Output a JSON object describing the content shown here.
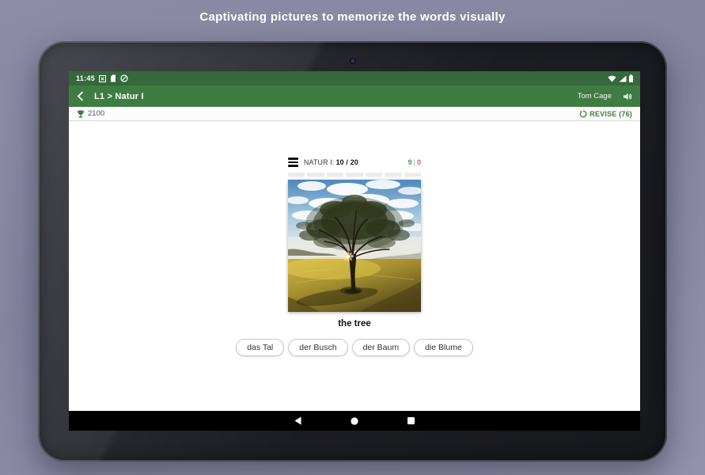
{
  "caption": "Captivating pictures to memorize the words visually",
  "colors": {
    "background_purple": "#8b8aa4",
    "status_bar_green": "#35683a",
    "app_bar_green": "#3f7c42",
    "revise_green": "#3f7c42",
    "correct_green": "#43a047",
    "wrong_red": "#e05a52"
  },
  "tablet": {
    "status_bar": {
      "time": "11:45"
    },
    "app_bar": {
      "breadcrumb": "L1 > Natur I",
      "user": "Tom Cage"
    },
    "points_bar": {
      "points": "2100",
      "revise_label": "REVISE (76)"
    },
    "quiz": {
      "lesson": "NATUR I:",
      "progress": "10 / 20",
      "score_correct": "9",
      "score_divider": "|",
      "score_wrong": "0",
      "progress_segments": 7,
      "word": "the tree",
      "answers": [
        "das Tal",
        "der Busch",
        "der Baum",
        "die Blume"
      ]
    }
  },
  "icons": {
    "status_left": [
      "app-notification-icon",
      "sim-card-icon",
      "data-saver-icon"
    ],
    "status_right": [
      "wifi-icon",
      "cell-signal-icon",
      "battery-icon"
    ],
    "app_bar": [
      "back-icon",
      "speaker-icon"
    ],
    "points_bar": [
      "trophy-icon",
      "sync-icon"
    ],
    "quiz": [
      "menu-icon"
    ],
    "nav_bar": [
      "nav-back-icon",
      "nav-home-icon",
      "nav-recents-icon"
    ]
  }
}
